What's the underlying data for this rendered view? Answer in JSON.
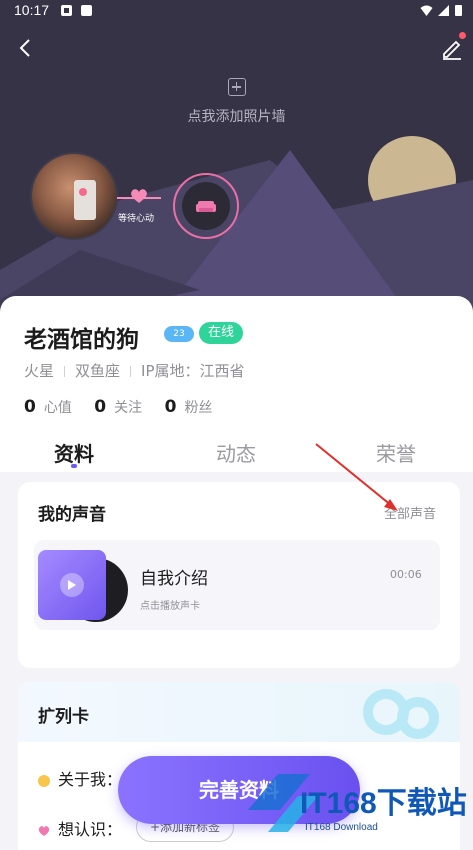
{
  "status_bar": {
    "time": "10:17"
  },
  "hero": {
    "add_photo_label": "点我添加照片墙",
    "waiting_label": "等待心动"
  },
  "profile": {
    "nickname": "老酒馆的狗",
    "level": "23",
    "online": "在线",
    "meta": [
      "火星",
      "双鱼座",
      "IP属地：江西省"
    ],
    "stats": [
      {
        "value": "0",
        "label": "心值"
      },
      {
        "value": "0",
        "label": "关注"
      },
      {
        "value": "0",
        "label": "粉丝"
      }
    ]
  },
  "tabs": [
    "资料",
    "动态",
    "荣誉"
  ],
  "voice": {
    "title": "我的声音",
    "view_all": "全部声音",
    "item_name": "自我介绍",
    "item_sub": "点击播放声卡",
    "item_duration": "00:06"
  },
  "expand_card": {
    "title": "扩列卡",
    "about_label": "关于我：",
    "know_label": "想认识：",
    "add_tag_label": "+添加新标签"
  },
  "complete_button": "完善资料",
  "watermark": {
    "brand": "IT168下载站",
    "sub": "IT168 Download"
  },
  "colors": {
    "accent": "#6b5cf5",
    "online": "#2fd49a",
    "level": "#5ab6f4",
    "hero_bg": "#353345"
  }
}
